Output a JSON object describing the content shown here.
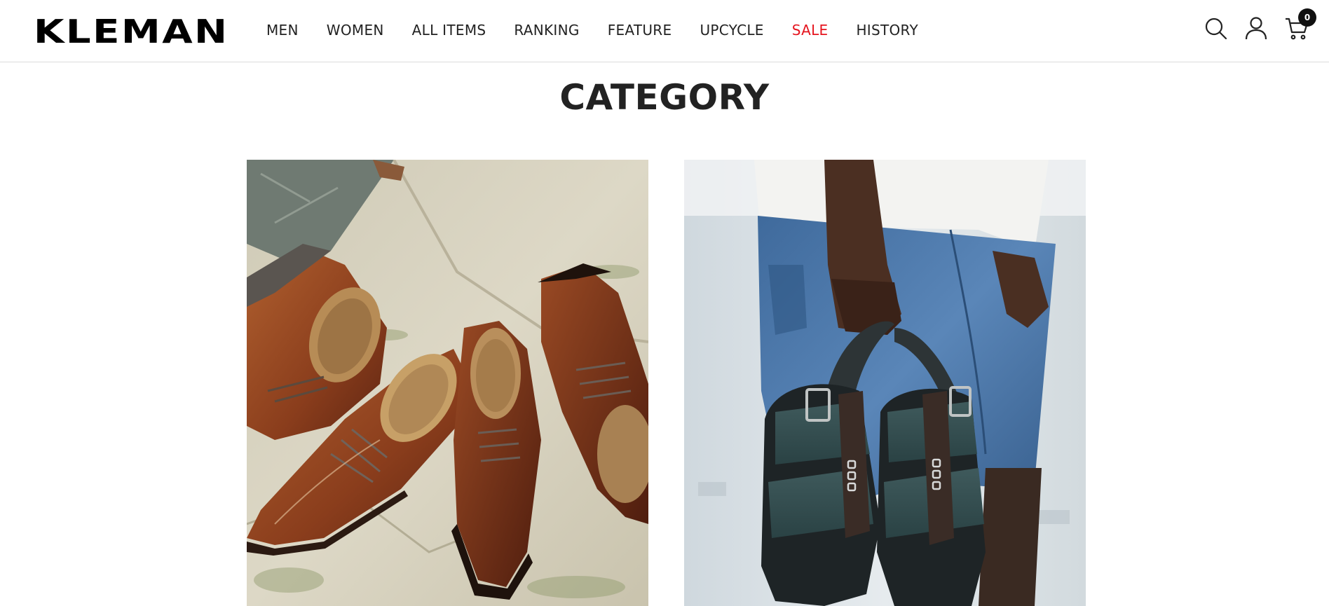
{
  "header": {
    "logo": "KLEMAN",
    "nav": [
      {
        "label": "MEN",
        "color": "#222222"
      },
      {
        "label": "WOMEN",
        "color": "#222222"
      },
      {
        "label": "ALL ITEMS",
        "color": "#222222"
      },
      {
        "label": "RANKING",
        "color": "#222222"
      },
      {
        "label": "FEATURE",
        "color": "#222222"
      },
      {
        "label": "UPCYCLE",
        "color": "#222222"
      },
      {
        "label": "SALE",
        "color": "#e5141e"
      },
      {
        "label": "HISTORY",
        "color": "#222222"
      }
    ],
    "icons": [
      "search-icon",
      "account-icon",
      "cart-icon"
    ],
    "cart_count": "0"
  },
  "main": {
    "section_title": "CATEGORY",
    "categories": [
      {
        "image": "brown-leather-derby-shoes-photo"
      },
      {
        "image": "green-suede-sandals-held-photo"
      }
    ]
  },
  "colors": {
    "text": "#222222",
    "sale": "#e5141e",
    "badge": "#111111"
  }
}
